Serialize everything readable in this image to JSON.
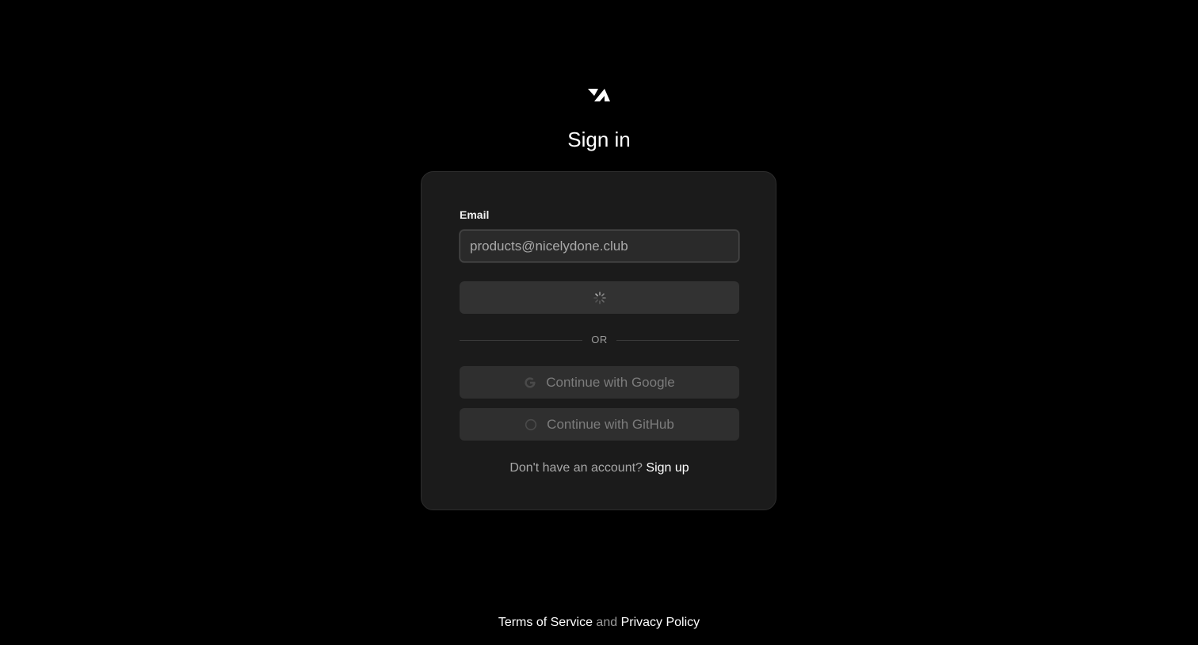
{
  "title": "Sign in",
  "form": {
    "email_label": "Email",
    "email_value": "products@nicelydone.club",
    "divider_text": "OR",
    "google_label": "Continue with Google",
    "github_label": "Continue with GitHub",
    "signup_prompt": "Don't have an account?",
    "signup_link": "Sign up"
  },
  "footer": {
    "terms": "Terms of Service",
    "and": "and",
    "privacy": "Privacy Policy"
  },
  "icons": {
    "logo": "brand-logo-icon",
    "spinner": "loading-spinner-icon",
    "google": "google-icon",
    "github": "github-icon"
  },
  "colors": {
    "background": "#000000",
    "card": "#1b1b1b",
    "input": "#2a2a2a",
    "button": "#323232"
  }
}
